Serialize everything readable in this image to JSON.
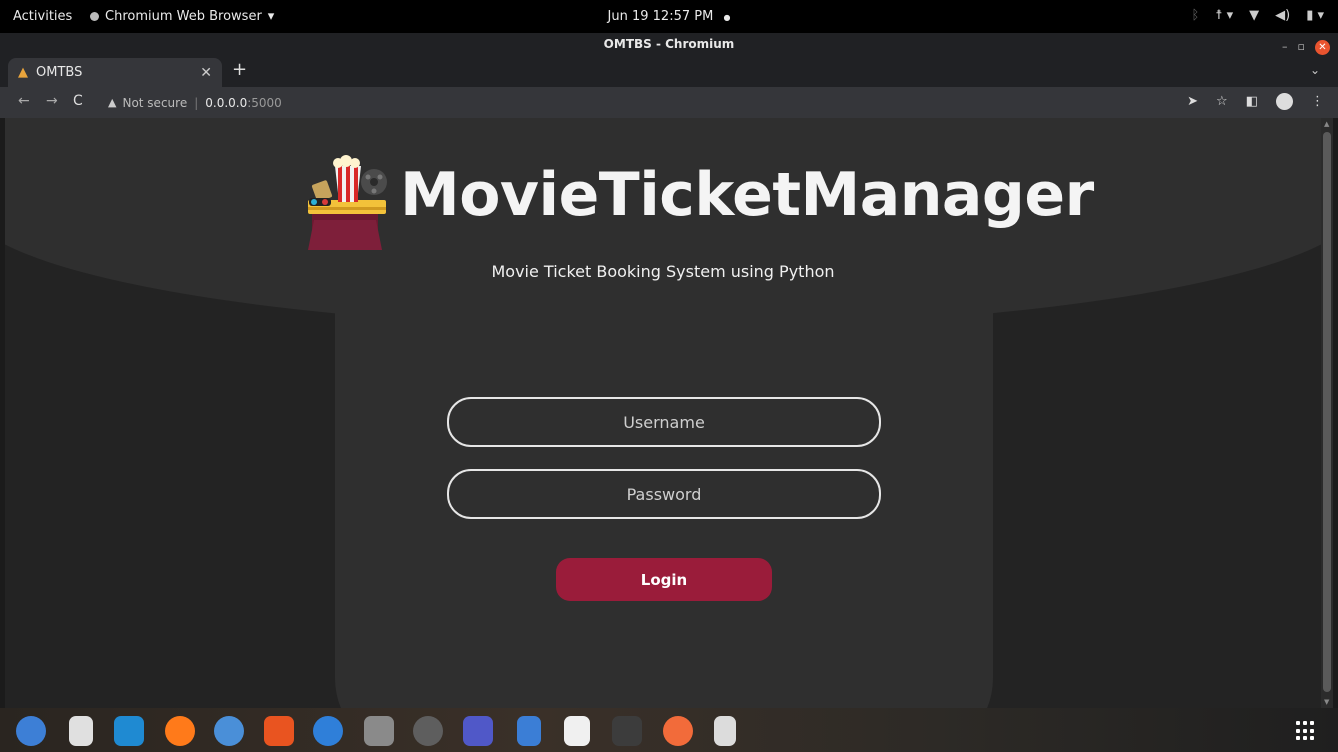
{
  "system_bar": {
    "activities": "Activities",
    "app_name": "Chromium Web Browser",
    "app_menu_arrow": "▾",
    "clock": "Jun 19  12:57 PM",
    "clock_dot": "●"
  },
  "window": {
    "title": "OMTBS - Chromium"
  },
  "tabs": [
    {
      "label": "OMTBS",
      "favicon": "popcorn-icon"
    }
  ],
  "address_bar": {
    "security_label": "Not secure",
    "url_host": "0.0.0.0",
    "url_port": ":5000"
  },
  "page": {
    "brand": "MovieTicketManager",
    "subtitle": "Movie Ticket Booking System using Python",
    "username_placeholder": "Username",
    "password_placeholder": "Password",
    "login_label": "Login"
  },
  "colors": {
    "accent": "#9a1c3a",
    "panel": "#2f2f2f",
    "background": "#232323"
  },
  "dock_items": [
    "thunderbird-icon",
    "document-viewer-icon",
    "vscode-icon",
    "firefox-icon",
    "chromium-icon",
    "software-center-icon",
    "help-icon",
    "files-icon",
    "settings-icon",
    "teams-icon",
    "text-editor-icon",
    "writer-icon",
    "terminal-icon",
    "postman-icon",
    "usb-creator-icon"
  ]
}
